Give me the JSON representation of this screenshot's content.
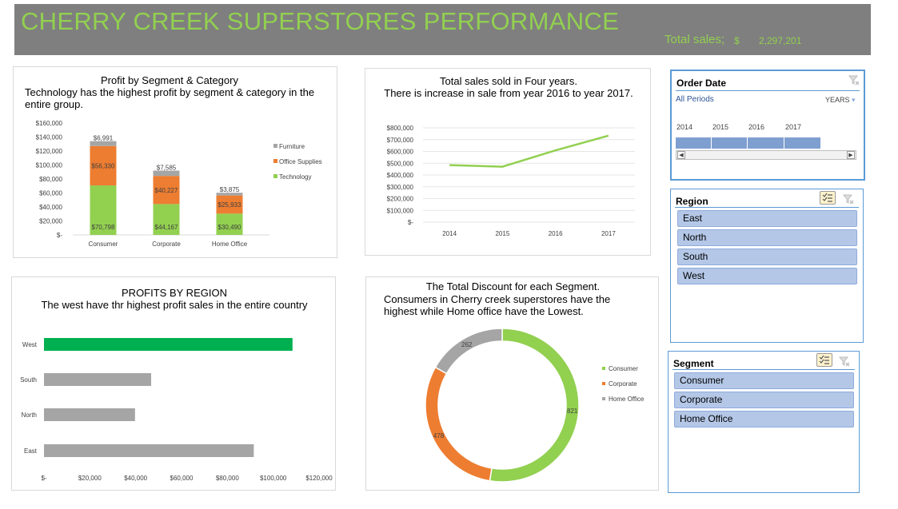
{
  "banner": {
    "title": "CHERRY CREEK SUPERSTORES PERFORMANCE",
    "sales_label": "Total sales;",
    "currency": "$",
    "sales_value": "2,297,201"
  },
  "colors": {
    "banner_bg": "#7f7f7f",
    "accent_green": "#92d050",
    "orange": "#ed7d31",
    "gray": "#a5a5a5",
    "highlight_green": "#00b050",
    "slicer_item": "#b4c7e7",
    "slicer_border": "#5b9bd5"
  },
  "panel_segment": {
    "title": "Profit by Segment & Category",
    "note": "Technology has the highest profit by  segment & category in the entire group."
  },
  "panel_sales": {
    "title_line1": "Total sales sold in Four years.",
    "title_line2": "There is increase in sale from year 2016 to year 2017."
  },
  "panel_region": {
    "title_line1": "PROFITS BY REGION",
    "title_line2": "The west have thr highest profit sales in the entire country"
  },
  "panel_discount": {
    "title_line1": "The Total Discount for each Segment.",
    "title_line2": "Consumers in Cherry creek superstores have the",
    "title_line3": "highest while Home office have the Lowest."
  },
  "slicer_date": {
    "header": "Order Date",
    "periods": "All Periods",
    "unit": "YEARS",
    "unit_arrow": "▾",
    "years": [
      "2014",
      "2015",
      "2016",
      "2017"
    ],
    "left_arrow": "◀",
    "right_arrow": "▶",
    "clear_icon": "clear-filter-icon"
  },
  "slicer_region": {
    "header": "Region",
    "items": [
      "East",
      "North",
      "South",
      "West"
    ],
    "multiselect_icon": "multiselect-icon",
    "clear_icon": "clear-filter-icon"
  },
  "slicer_segment": {
    "header": "Segment",
    "items": [
      "Consumer",
      "Corporate",
      "Home Office"
    ],
    "multiselect_icon": "multiselect-icon",
    "clear_icon": "clear-filter-icon"
  },
  "chart_data": [
    {
      "type": "bar",
      "stacked": true,
      "categories": [
        "Consumer",
        "Corporate",
        "Home Office"
      ],
      "series": [
        {
          "name": "Technology",
          "values": [
            70798,
            44167,
            30490
          ],
          "labels": [
            "$70,798",
            "$44,167",
            "$30,490"
          ],
          "color": "#92d050"
        },
        {
          "name": "Office Supplies",
          "values": [
            56330,
            40227,
            25933
          ],
          "labels": [
            "$56,330",
            "$40,227",
            "$25,933"
          ],
          "color": "#ed7d31"
        },
        {
          "name": "Furniture",
          "values": [
            6991,
            7585,
            3875
          ],
          "labels": [
            "$6,991",
            "$7,585",
            "$3,875"
          ],
          "color": "#a5a5a5"
        }
      ],
      "legend_order": [
        "Furniture",
        "Office Supplies",
        "Technology"
      ],
      "ylim": [
        0,
        160000
      ],
      "yticks": [
        0,
        20000,
        40000,
        60000,
        80000,
        100000,
        120000,
        140000,
        160000
      ],
      "ytick_labels": [
        "$-",
        "$20,000",
        "$40,000",
        "$60,000",
        "$80,000",
        "$100,000",
        "$120,000",
        "$140,000",
        "$160,000"
      ],
      "legend": "right"
    },
    {
      "type": "line",
      "x": [
        "2014",
        "2015",
        "2016",
        "2017"
      ],
      "series": [
        {
          "values": [
            484247,
            470533,
            609206,
            733215
          ],
          "color": "#92d050"
        }
      ],
      "ylim": [
        0,
        800000
      ],
      "yticks": [
        0,
        100000,
        200000,
        300000,
        400000,
        500000,
        600000,
        700000,
        800000
      ],
      "ytick_labels": [
        "$-",
        "$100,000",
        "$200,000",
        "$300,000",
        "$400,000",
        "$500,000",
        "$600,000",
        "$700,000",
        "$800,000"
      ],
      "grid": true
    },
    {
      "type": "bar",
      "orientation": "horizontal",
      "categories": [
        "West",
        "South",
        "North",
        "East"
      ],
      "values": [
        108418,
        46749,
        39706,
        91523
      ],
      "colors": [
        "#00b050",
        "#a5a5a5",
        "#a5a5a5",
        "#a5a5a5"
      ],
      "xlim": [
        0,
        120000
      ],
      "xticks": [
        0,
        20000,
        40000,
        60000,
        80000,
        100000,
        120000
      ],
      "xtick_labels": [
        "$-",
        "$20,000",
        "$40,000",
        "$60,000",
        "$80,000",
        "$100,000",
        "$120,000"
      ]
    },
    {
      "type": "pie",
      "donut": true,
      "categories": [
        "Consumer",
        "Corporate",
        "Home Office"
      ],
      "values": [
        821,
        478,
        262
      ],
      "labels": [
        "821",
        "478",
        "262"
      ],
      "colors": [
        "#92d050",
        "#ed7d31",
        "#a5a5a5"
      ],
      "legend": "right"
    }
  ]
}
